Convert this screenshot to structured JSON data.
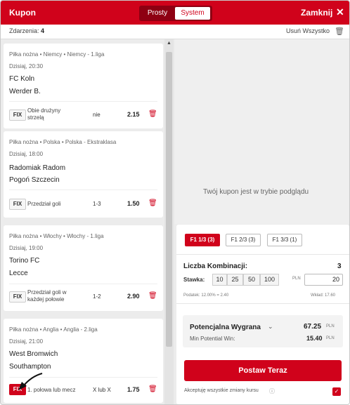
{
  "header": {
    "title": "Kupon",
    "mode_tabs": [
      "Prosty",
      "System"
    ],
    "active_tab": "System",
    "close_label": "Zamknij",
    "close_icon": "close-x-icon"
  },
  "subbar": {
    "events_label": "Zdarzenia:",
    "events_count": "4",
    "remove_all_label": "Usuń Wszystko",
    "remove_all_icon": "trash-icon"
  },
  "bets": [
    {
      "league": "Piłka nożna • Niemcy • Niemcy - 1.liga",
      "time": "Dzisiaj, 20:30",
      "home": "FC Koln",
      "away": "Werder B.",
      "fix": "FIX",
      "market": "Obie drużyny strzelą",
      "pick": "nie",
      "odd": "2.15"
    },
    {
      "league": "Piłka nożna • Polska • Polska - Ekstraklasa",
      "time": "Dzisiaj, 18:00",
      "home": "Radomiak Radom",
      "away": "Pogoń Szczecin",
      "fix": "FIX",
      "market": "Przedział goli",
      "pick": "1-3",
      "odd": "1.50"
    },
    {
      "league": "Piłka nożna • Włochy • Włochy - 1.liga",
      "time": "Dzisiaj, 19:00",
      "home": "Torino FC",
      "away": "Lecce",
      "fix": "FIX",
      "market": "Przedział goli w każdej połowie",
      "pick": "1-2",
      "odd": "2.90"
    },
    {
      "league": "Piłka nożna • Anglia • Anglia - 2.liga",
      "time": "Dzisiaj, 21:00",
      "home": "West Bromwich",
      "away": "Southampton",
      "fix": "FIX",
      "market": "1. połowa lub mecz",
      "pick": "X lub X",
      "odd": "1.75"
    }
  ],
  "preview_message": "Twój kupon jest w trybie podglądu",
  "panel": {
    "systems": [
      "F1 1/3 (3)",
      "F1 2/3 (3)",
      "F1 3/3 (1)"
    ],
    "active_system": "F1 1/3 (3)",
    "combinations_label": "Liczba Kombinacji:",
    "combinations_value": "3",
    "stake_label": "Stawka:",
    "stake_presets": [
      "10",
      "25",
      "50",
      "100"
    ],
    "currency": "PLN",
    "stake_value": "20",
    "tax_text": "Podatek: 12.00% = 2.40",
    "deposit_text": "Wkład: 17.60",
    "potential_label": "Potencjalna Wygrana",
    "potential_value": "67.25",
    "min_label": "Min Potential Win:",
    "min_value": "15.40",
    "place_bet_label": "Postaw Teraz",
    "accept_label": "Akceptuję wszystkie zmiany kursu",
    "accept_checked": true
  },
  "colors": {
    "brand": "#d0021b",
    "brand_dark": "#8e0012",
    "background": "#ececec"
  }
}
